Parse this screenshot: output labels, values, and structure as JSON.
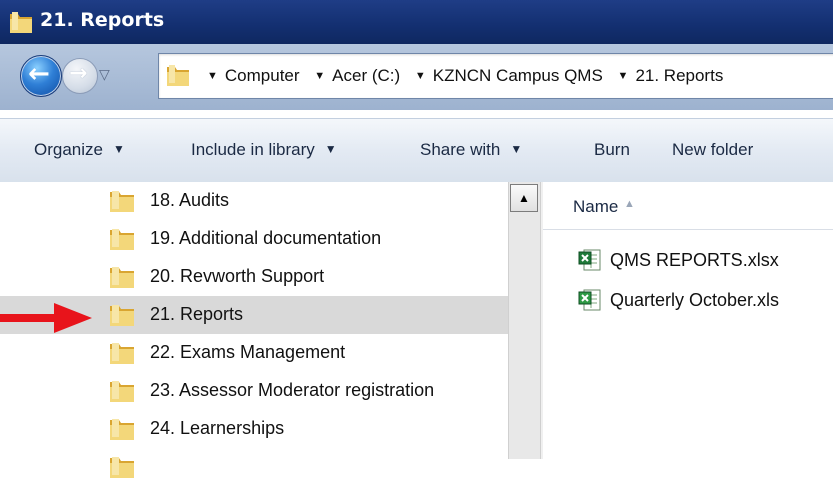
{
  "window": {
    "title": "21. Reports"
  },
  "nav": {
    "back_glyph": "←",
    "forward_glyph": "→",
    "history_glyph": "▽"
  },
  "breadcrumb": [
    {
      "label": "Computer"
    },
    {
      "label": "Acer (C:)"
    },
    {
      "label": "KZNCN Campus QMS"
    },
    {
      "label": "21. Reports"
    }
  ],
  "toolbar": {
    "organize": "Organize",
    "include_in_library": "Include in library",
    "share_with": "Share with",
    "burn": "Burn",
    "new_folder": "New folder"
  },
  "folders": [
    {
      "label": "18. Audits",
      "selected": false
    },
    {
      "label": "19. Additional documentation",
      "selected": false
    },
    {
      "label": "20. Revworth Support",
      "selected": false
    },
    {
      "label": "21. Reports",
      "selected": true
    },
    {
      "label": "22. Exams Management",
      "selected": false
    },
    {
      "label": "23. Assessor Moderator registration",
      "selected": false
    },
    {
      "label": "24. Learnerships",
      "selected": false
    }
  ],
  "content": {
    "column_name": "Name",
    "sort_glyph": "▲",
    "files": [
      {
        "label": "QMS REPORTS.xlsx",
        "icon": "excel-xlsx-icon"
      },
      {
        "label": "Quarterly October.xls",
        "icon": "excel-xls-icon"
      }
    ]
  },
  "annotation": {
    "icon": "red-arrow-icon",
    "color": "#e8141b"
  },
  "colors": {
    "titlebar": "#1f3d86",
    "selected_row": "#d9d9d9",
    "folder": "#e8c25a"
  }
}
